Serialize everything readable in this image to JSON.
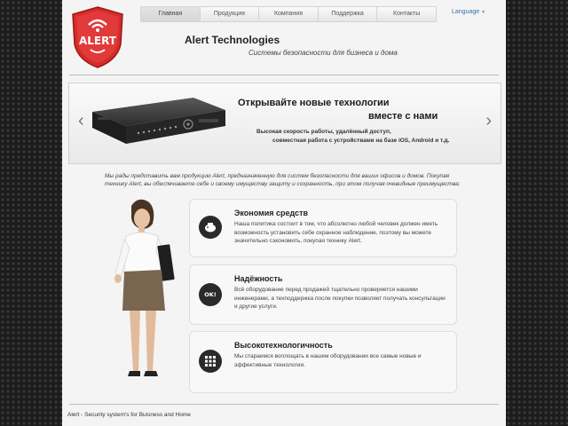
{
  "logo": {
    "text": "ALERT"
  },
  "nav": {
    "items": [
      "Главная",
      "Продукция",
      "Компания",
      "Поддержка",
      "Контакты"
    ],
    "active": "Главная"
  },
  "language": {
    "label": "Language"
  },
  "brand": {
    "title": "Alert Technologies",
    "subtitle": "Системы безопасности для бизнеса и дома"
  },
  "banner": {
    "heading_line1": "Открывайте новые технологии",
    "heading_line2": "вместе с нами",
    "text_line1": "Высокая скорость работы, удалённый доступ,",
    "text_line2": "совместная работа с устройствами на базе iOS, Android и т.д.",
    "prev": "‹",
    "next": "›"
  },
  "intro": "Мы рады представить вам продукцию Alert, предназначенную для систем безопасности для ваших офисов и домов. Покупая технику Alert, вы обеспечиваете себе и своему имуществу защиту и сохранность, при этом получая очевидные преимущества:",
  "features": [
    {
      "icon": "piggy-bank-icon",
      "title": "Экономия средств",
      "text": "Наша политика состоит в том, что абсолютно любой человек должен иметь возможность установить себе охранное наблюдение, поэтому вы можете значительно сэкономить, покупая технику Alert."
    },
    {
      "icon": "ok-speech-icon",
      "title": "Надёжность",
      "text": "Всё оборудование перед продажей тщательно проверяется нашими инженерами, а техподдержка после покупки позволяет получать консультации и другие услуги."
    },
    {
      "icon": "tech-grid-icon",
      "title": "Высокотехнологичность",
      "text": "Мы стараемся воплощать в нашем оборудовании все самые новые и эффективные технологии."
    }
  ],
  "footer": "Alert - Security system's for Buisness and Home",
  "colors": {
    "logo_red": "#d62b2b",
    "accent_blue": "#3a6fb0",
    "icon_dark": "#2a2a2a"
  }
}
